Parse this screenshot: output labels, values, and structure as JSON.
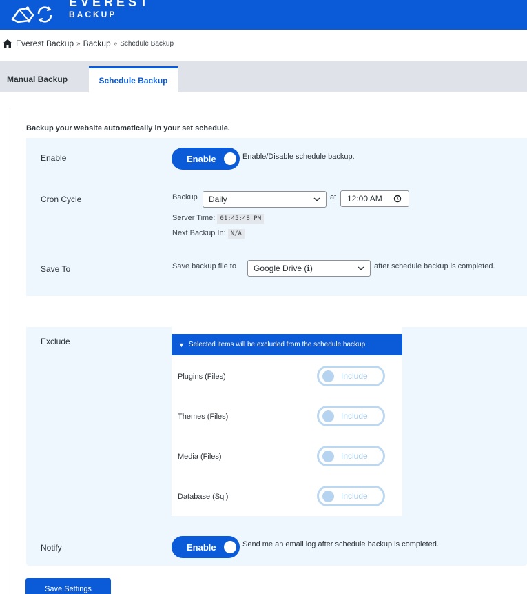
{
  "brand": {
    "name_top": "EVEREST",
    "name_bottom": "BACKUP",
    "color": "#0b5bd8"
  },
  "breadcrumb": {
    "items": [
      "Everest Backup",
      "Backup",
      "Schedule Backup"
    ],
    "separator": "»"
  },
  "tabs": [
    {
      "label": "Manual Backup",
      "active": false
    },
    {
      "label": "Schedule Backup",
      "active": true
    }
  ],
  "intro": "Backup your website automatically in your set schedule.",
  "enable": {
    "label": "Enable",
    "toggle_label": "Enable",
    "toggle_on": true,
    "description": "Enable/Disable schedule backup."
  },
  "cron": {
    "label": "Cron Cycle",
    "backup_label": "Backup",
    "frequency_value": "Daily",
    "at_label": "at",
    "time_value": "12:00 AM",
    "server_time_label": "Server Time:",
    "server_time_value": "01:45:48 PM",
    "next_backup_label": "Next Backup In:",
    "next_backup_value": "N/A"
  },
  "save_to": {
    "label": "Save To",
    "prefix": "Save backup file to",
    "value": "Google Drive (ℹ)",
    "suffix": "after schedule backup is completed."
  },
  "exclude": {
    "label": "Exclude",
    "header": "Selected items will be excluded from the schedule backup",
    "items": [
      {
        "label": "Plugins (Files)",
        "toggle_label": "Include",
        "toggle_on": false
      },
      {
        "label": "Themes (Files)",
        "toggle_label": "Include",
        "toggle_on": false
      },
      {
        "label": "Media (Files)",
        "toggle_label": "Include",
        "toggle_on": false
      },
      {
        "label": "Database (Sql)",
        "toggle_label": "Include",
        "toggle_on": false
      }
    ]
  },
  "notify": {
    "label": "Notify",
    "toggle_label": "Enable",
    "toggle_on": true,
    "description": "Send me an email log after schedule backup is completed."
  },
  "save_button": "Save Settings"
}
